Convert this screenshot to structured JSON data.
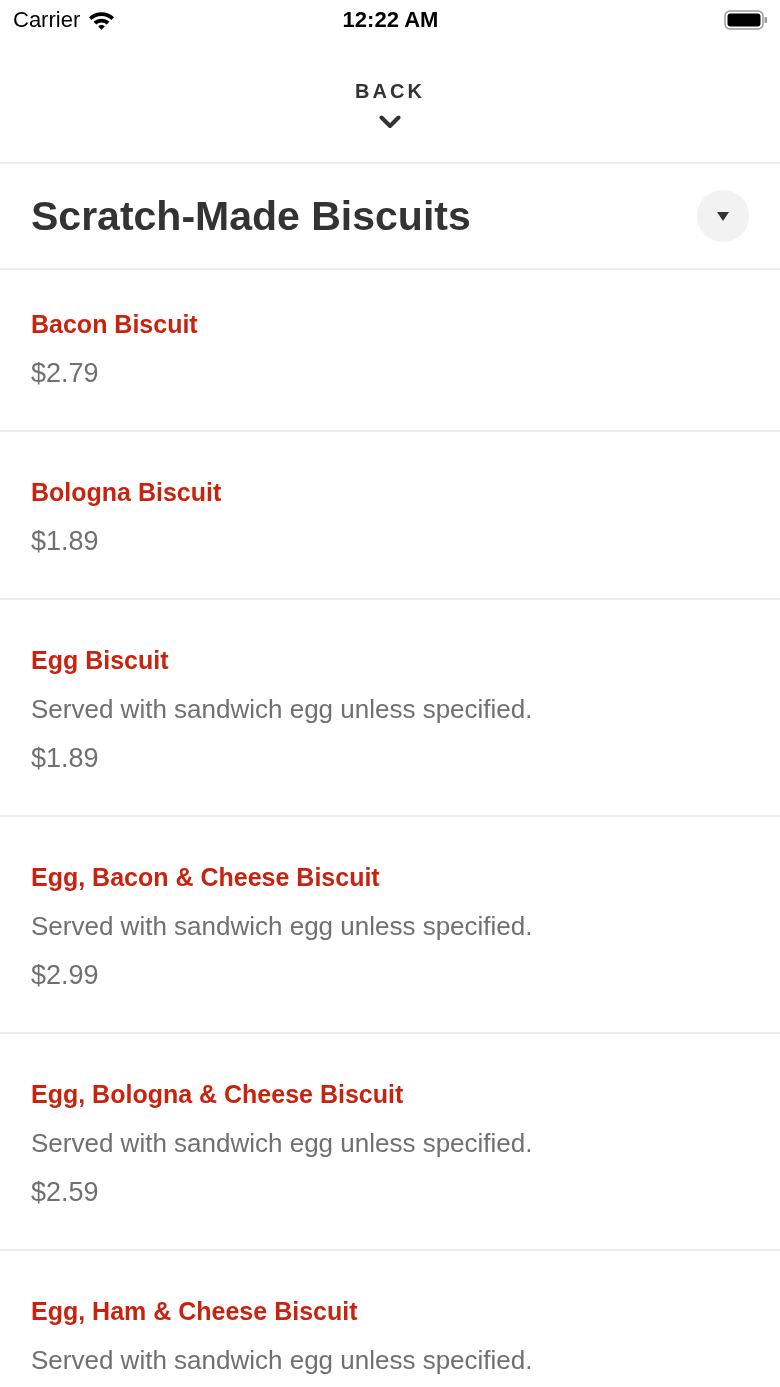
{
  "status_bar": {
    "carrier": "Carrier",
    "time": "12:22 AM"
  },
  "header": {
    "back_label": "BACK"
  },
  "section": {
    "title": "Scratch-Made Biscuits"
  },
  "items": [
    {
      "name": "Bacon Biscuit",
      "price": "$2.79"
    },
    {
      "name": "Bologna Biscuit",
      "price": "$1.89"
    },
    {
      "name": "Egg Biscuit",
      "description": "Served with sandwich egg unless specified.",
      "price": "$1.89"
    },
    {
      "name": "Egg, Bacon & Cheese Biscuit",
      "description": "Served with sandwich egg unless specified.",
      "price": "$2.99"
    },
    {
      "name": "Egg, Bologna & Cheese Biscuit",
      "description": "Served with sandwich egg unless specified.",
      "price": "$2.59"
    },
    {
      "name": "Egg, Ham & Cheese Biscuit",
      "description": "Served with sandwich egg unless specified."
    }
  ]
}
